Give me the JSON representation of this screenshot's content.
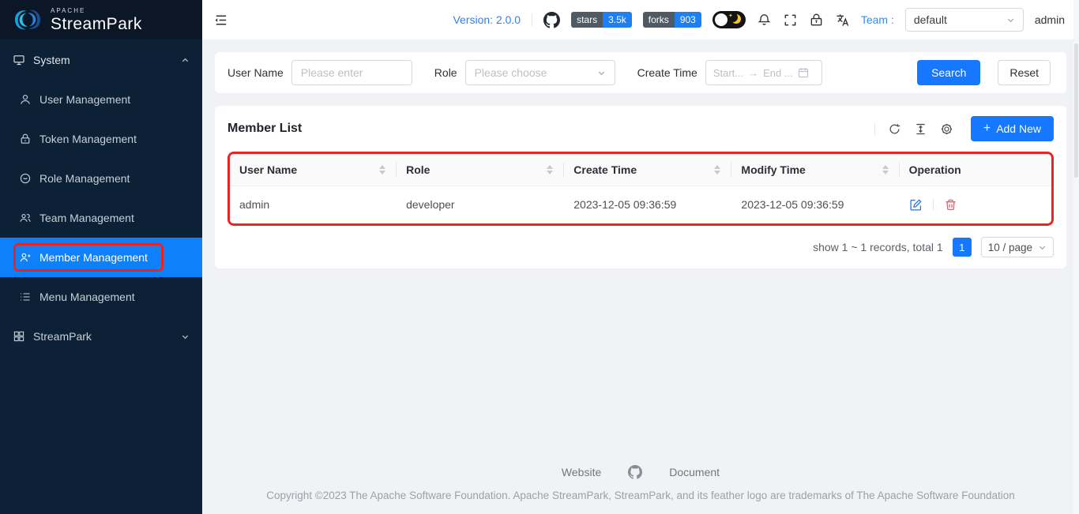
{
  "app": {
    "brand_small": "APACHE",
    "brand": "StreamPark"
  },
  "sidebar": {
    "system_label": "System",
    "items": [
      {
        "label": "User Management"
      },
      {
        "label": "Token Management"
      },
      {
        "label": "Role Management"
      },
      {
        "label": "Team Management"
      },
      {
        "label": "Member Management"
      },
      {
        "label": "Menu Management"
      }
    ],
    "streampark_label": "StreamPark"
  },
  "header": {
    "version_label": "Version: 2.0.0",
    "stars_label": "stars",
    "stars_value": "3.5k",
    "forks_label": "forks",
    "forks_value": "903",
    "team_label": "Team :",
    "team_selected": "default",
    "username": "admin"
  },
  "filters": {
    "user_name_label": "User Name",
    "user_name_placeholder": "Please enter",
    "role_label": "Role",
    "role_placeholder": "Please choose",
    "create_time_label": "Create Time",
    "start_placeholder": "Start...",
    "range_arrow": "→",
    "end_placeholder": "End ...",
    "search_label": "Search",
    "reset_label": "Reset"
  },
  "member_list": {
    "title": "Member List",
    "add_new_label": "Add New",
    "plus_glyph": "+",
    "columns": [
      "User Name",
      "Role",
      "Create Time",
      "Modify Time",
      "Operation"
    ],
    "rows": [
      {
        "user_name": "admin",
        "role": "developer",
        "create_time": "2023-12-05 09:36:59",
        "modify_time": "2023-12-05 09:36:59"
      }
    ],
    "pagination": {
      "summary": "show 1 ~ 1 records, total 1",
      "current_page": "1",
      "page_size": "10 / page"
    }
  },
  "footer": {
    "website_label": "Website",
    "document_label": "Document",
    "copyright": "Copyright ©2023 The Apache Software Foundation. Apache StreamPark, StreamPark, and its feather logo are trademarks of The Apache Software Foundation"
  },
  "colors": {
    "accent": "#1677ff",
    "sidebar_selected": "#0e80fa",
    "sidebar_bg": "#0c2135",
    "annotation_red": "#e82525",
    "badge_label_bg": "#505a62",
    "badge_value_bg": "#1d7ff0"
  },
  "icons": {
    "theme_star": "✦"
  }
}
